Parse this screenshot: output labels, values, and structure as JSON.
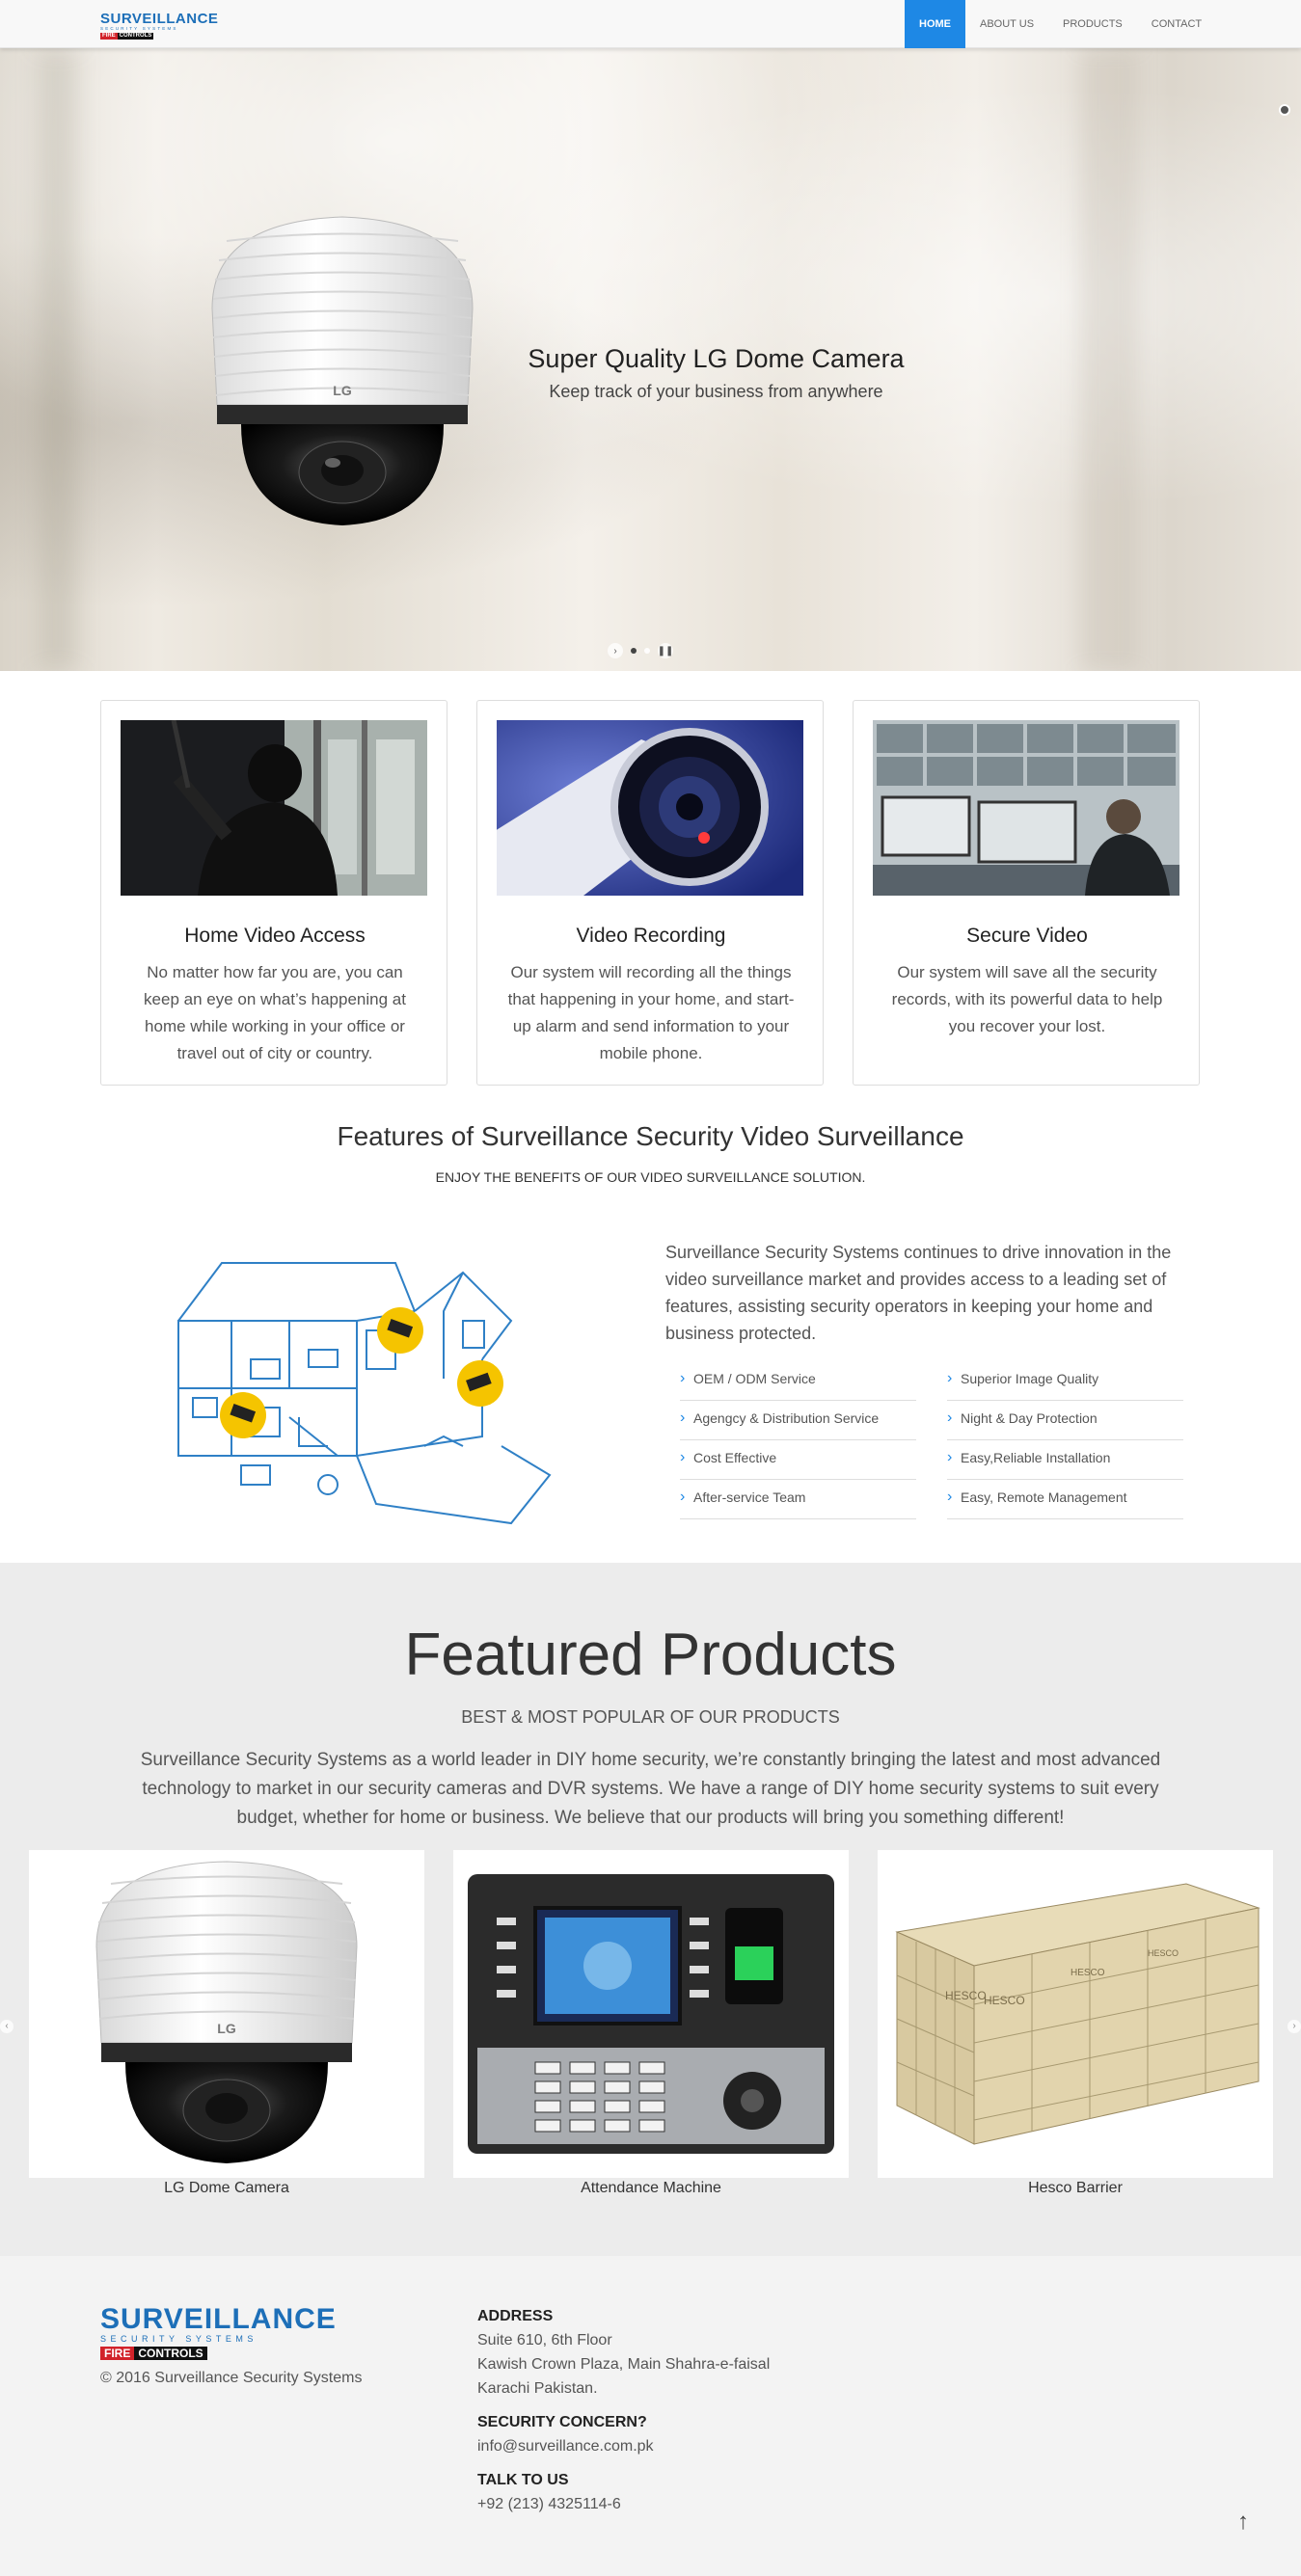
{
  "brand": {
    "name": "SURVEILLANCE",
    "tagline": "SECURITY SYSTEMS",
    "fire": "FIRE",
    "controls": "CONTROLS"
  },
  "nav": {
    "items": [
      "HOME",
      "ABOUT US",
      "PRODUCTS",
      "CONTACT"
    ],
    "active": "HOME"
  },
  "hero": {
    "title": "Super Quality LG Dome Camera",
    "subtitle": "Keep track of your business from anywhere",
    "camera_brand": "LG",
    "slides": 2,
    "active_slide": 1
  },
  "services": [
    {
      "title": "Home Video Access",
      "text": "No matter how far you are, you can keep an eye on what’s happening at home while working in your office or travel out of city or country."
    },
    {
      "title": "Video Recording",
      "text": "Our system will recording all the things that happening in your home, and start-up alarm and send information to your mobile phone."
    },
    {
      "title": "Secure Video",
      "text": "Our system will save all the security records, with its powerful data to help you recover your lost."
    }
  ],
  "features": {
    "title": "Features of Surveillance Security Video Surveillance",
    "subtitle": "ENJOY THE BENEFITS OF OUR VIDEO SURVEILLANCE SOLUTION.",
    "text": "Surveillance Security Systems continues to drive innovation in the video surveillance market and provides access to a leading set of features, assisting security operators in keeping your home and business protected.",
    "left_list": [
      "OEM / ODM Service",
      "Agengcy & Distribution Service",
      "Cost Effective",
      "After-service Team"
    ],
    "right_list": [
      "Superior Image Quality",
      "Night & Day Protection",
      "Easy,Reliable Installation",
      "Easy, Remote Management"
    ]
  },
  "products": {
    "title": "Featured Products",
    "subtitle": "BEST & MOST POPULAR OF OUR PRODUCTS",
    "text": "Surveillance Security Systems as a world leader in DIY home security, we’re constantly bringing the latest and most advanced technology to market in our security cameras and DVR systems. We have a range of DIY home security systems to suit every budget, whether for home or business. We believe that our products will bring you something different!",
    "items": [
      {
        "name": "LG Dome Camera"
      },
      {
        "name": "Attendance Machine"
      },
      {
        "name": "Hesco Barrier"
      }
    ],
    "barrier_label": "HESCO"
  },
  "footer": {
    "copyright": "© 2016 Surveillance Security Systems",
    "address_label": "ADDRESS",
    "address": [
      "Suite 610, 6th Floor",
      "Kawish Crown Plaza, Main Shahra-e-faisal",
      "Karachi Pakistan."
    ],
    "concern_label": "SECURITY CONCERN?",
    "email": "info@surveillance.com.pk",
    "talk_label": "TALK TO US",
    "phone": "+92 (213) 4325114-6",
    "to_top": "↑"
  },
  "colors": {
    "accent": "#1e88e5",
    "brand_blue": "#1d6fb8",
    "fire_red": "#d2232a",
    "products_bg": "#ececec",
    "footer_bg": "#f3f3f3"
  }
}
